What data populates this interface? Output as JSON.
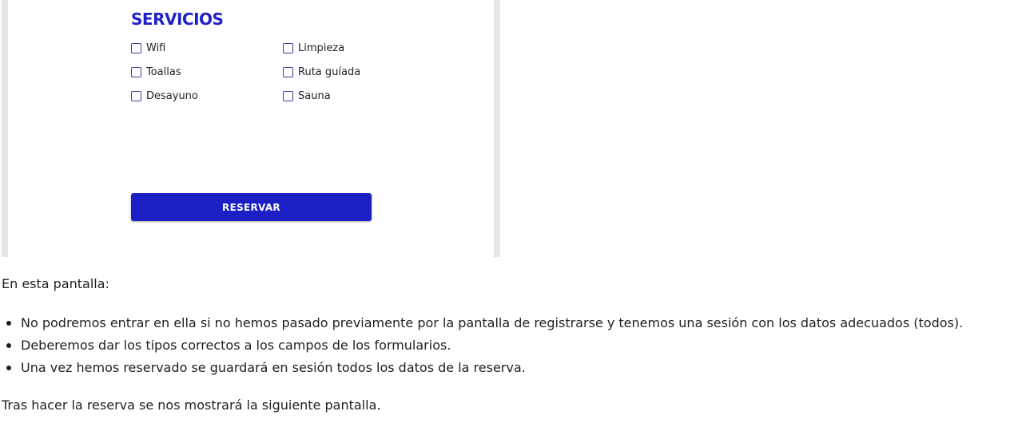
{
  "form": {
    "title": "SERVICIOS",
    "services": [
      {
        "label": "Wifi",
        "checked": false
      },
      {
        "label": "Limpieza",
        "checked": false
      },
      {
        "label": "Toallas",
        "checked": false
      },
      {
        "label": "Ruta guíada",
        "checked": false
      },
      {
        "label": "Desayuno",
        "checked": false
      },
      {
        "label": "Sauna",
        "checked": false
      }
    ],
    "submit_label": "RESERVAR",
    "accent_color": "#1b1fc4"
  },
  "document": {
    "intro": "En esta pantalla:",
    "bullets": [
      "No podremos entrar en ella si no hemos pasado previamente por la pantalla de registrarse y tenemos una sesión con los datos adecuados (todos).",
      "Deberemos dar los tipos correctos a los campos de los formularios.",
      "Una vez hemos reservado se guardará en sesión todos los datos de la reserva."
    ],
    "outro": "Tras hacer la reserva se nos mostrará la siguiente pantalla."
  }
}
